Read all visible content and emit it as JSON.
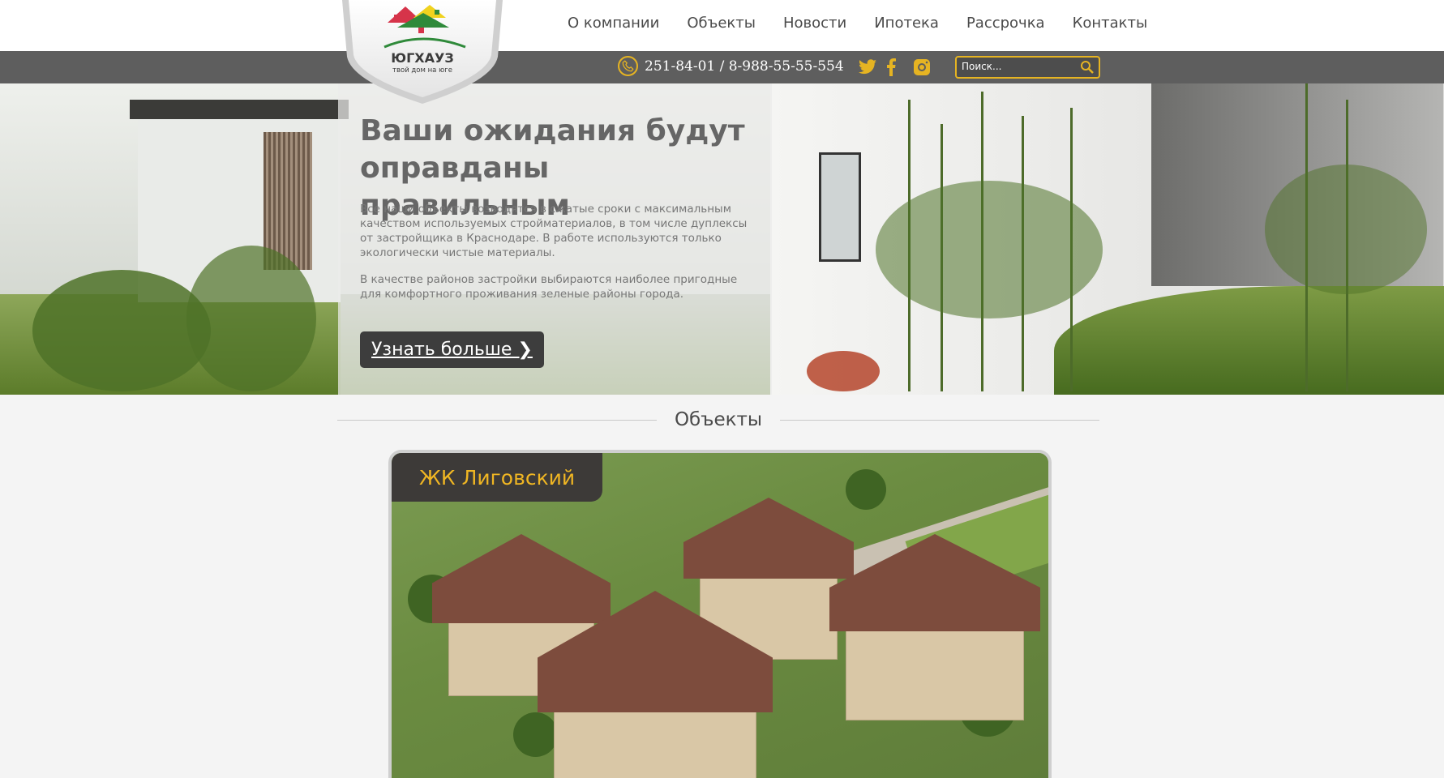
{
  "brand": {
    "name": "ЮГХАУЗ",
    "tagline": "твой дом на юге",
    "colors": {
      "accent": "#f0b623",
      "dark": "#3d3d3d",
      "bar": "#5e5e5e"
    }
  },
  "nav": {
    "items": [
      {
        "label": "О компании"
      },
      {
        "label": "Объекты"
      },
      {
        "label": "Новости"
      },
      {
        "label": "Ипотека"
      },
      {
        "label": "Рассрочка"
      },
      {
        "label": "Контакты"
      }
    ]
  },
  "contacts": {
    "phone_icon": "phone-icon",
    "phones": "251-84-01  /  8-988-55-55-554",
    "social": [
      {
        "icon": "twitter-icon"
      },
      {
        "icon": "facebook-icon"
      },
      {
        "icon": "instagram-icon"
      }
    ]
  },
  "search": {
    "placeholder": "Поиск...",
    "icon": "search-icon"
  },
  "hero": {
    "title": "Ваши ожидания будут оправданы правильным",
    "paragraph1": "Все наши объекты возводятся в сжатые сроки с максимальным качеством используемых стройматериалов, в том числе дуплексы от застройщика в Краснодаре. В работе используются только экологически чистые материалы.",
    "paragraph2": "В качестве районов застройки выбираются наиболее пригодные для комфортного проживания зеленые районы города.",
    "button": "Узнать больше ❯"
  },
  "objects": {
    "section_title": "Объекты",
    "cards": [
      {
        "title": "ЖК Лиговский"
      }
    ]
  }
}
